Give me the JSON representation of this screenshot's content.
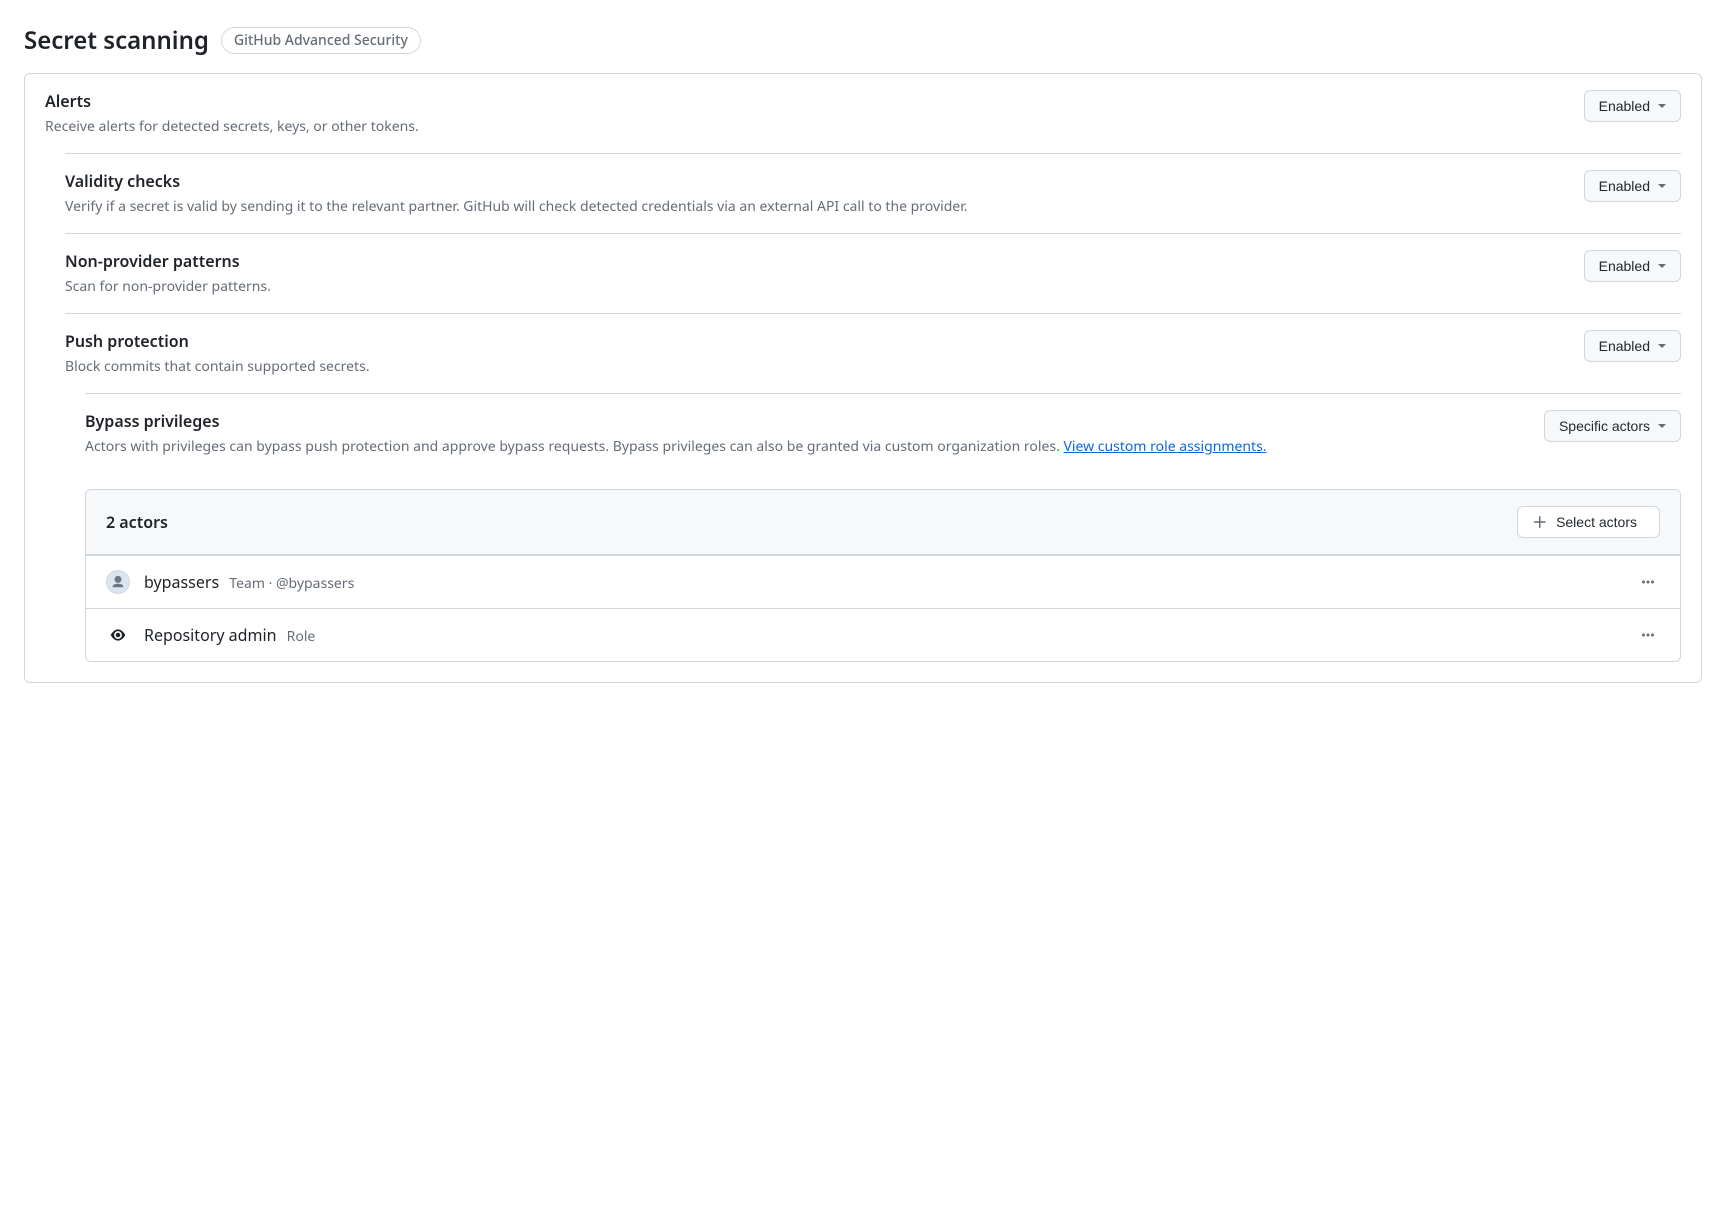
{
  "header": {
    "title": "Secret scanning",
    "badge": "GitHub Advanced Security"
  },
  "settings": {
    "alerts": {
      "title": "Alerts",
      "description": "Receive alerts for detected secrets, keys, or other tokens.",
      "status": "Enabled"
    },
    "validity_checks": {
      "title": "Validity checks",
      "description": "Verify if a secret is valid by sending it to the relevant partner. GitHub will check detected credentials via an external API call to the provider.",
      "status": "Enabled"
    },
    "non_provider_patterns": {
      "title": "Non-provider patterns",
      "description": "Scan for non-provider patterns.",
      "status": "Enabled"
    },
    "push_protection": {
      "title": "Push protection",
      "description": "Block commits that contain supported secrets.",
      "status": "Enabled"
    },
    "bypass_privileges": {
      "title": "Bypass privileges",
      "description_prefix": "Actors with privileges can bypass push protection and approve bypass requests. Bypass privileges can also be granted via custom organization roles. ",
      "link_text": "View custom role assignments.",
      "status": "Specific actors"
    }
  },
  "actors_panel": {
    "count_label": "2 actors",
    "select_label": "Select actors",
    "items": [
      {
        "name": "bypassers",
        "meta": "Team · @bypassers",
        "icon_type": "avatar"
      },
      {
        "name": "Repository admin",
        "meta": "Role",
        "icon_type": "eye"
      }
    ]
  }
}
